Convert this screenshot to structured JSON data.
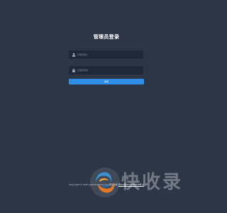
{
  "title": "管理员登录",
  "username": {
    "placeholder": "管理员账户",
    "value": "",
    "icon": "user-icon"
  },
  "password": {
    "placeholder": "管理员密码",
    "value": "",
    "icon": "lock-icon"
  },
  "login_button": {
    "label": "登录"
  },
  "footer": {
    "copyright": "Copyright © 2023 ·phlzcwnswor.com",
    "site_name": "聚星网络",
    "icp": "粤ICP备2023089858号-2"
  },
  "watermark": {
    "text": "快收录"
  },
  "colors": {
    "background": "#2c3646",
    "field": "#1f2836",
    "button": "#2f8fe8"
  }
}
